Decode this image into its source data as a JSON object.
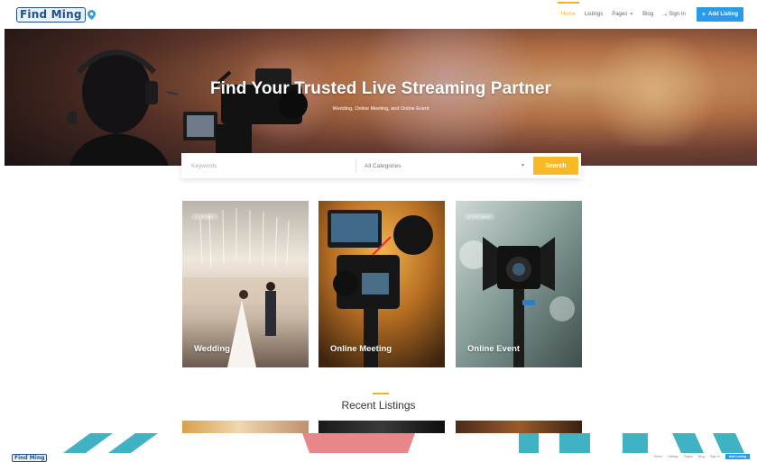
{
  "nav": {
    "logo": "Find Ming",
    "links": [
      {
        "label": "Home",
        "active": true
      },
      {
        "label": "Listings",
        "active": false
      },
      {
        "label": "Pages",
        "active": false,
        "dropdown": true
      },
      {
        "label": "Blog",
        "active": false
      }
    ],
    "signin": "Sign In",
    "add_listing": "Add Listing"
  },
  "hero": {
    "title": "Find Your Trusted Live Streaming Partner",
    "subtitle": "Wedding, Online Meeting, and Online Event"
  },
  "search": {
    "keywords_placeholder": "Keywords",
    "category_value": "All Categories",
    "button": "Search"
  },
  "categories": [
    {
      "label": "Wedding",
      "badge": "1 LISTING"
    },
    {
      "label": "Online Meeting",
      "badge": ""
    },
    {
      "label": "Online Event",
      "badge": "3 LISTINGS"
    }
  ],
  "recent": {
    "title": "Recent Listings"
  },
  "colors": {
    "accent": "#f3b21a",
    "primary": "#2b9ae8",
    "search_button": "#f7b924"
  },
  "icons": {
    "pin": "map-pin-icon",
    "plus": "plus-icon",
    "signin": "signin-icon",
    "caret": "chevron-down-icon"
  }
}
